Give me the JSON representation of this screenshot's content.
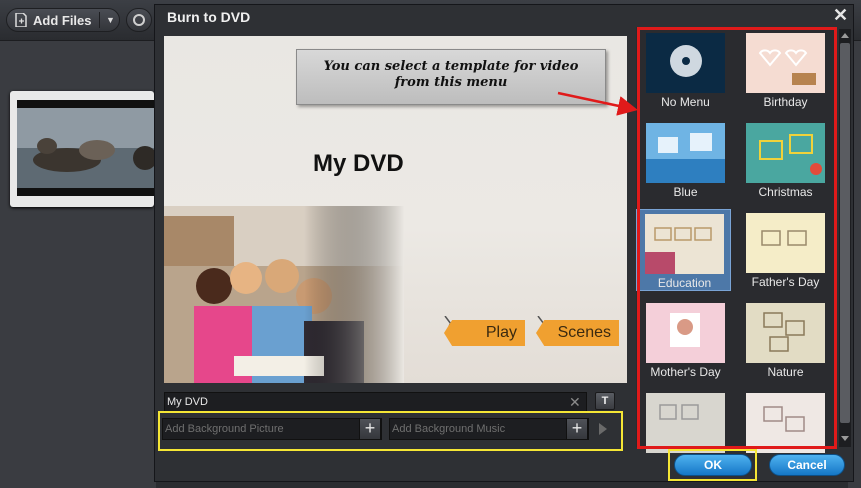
{
  "toolbar": {
    "add_files_label": "Add Files"
  },
  "dialog": {
    "title": "Burn to DVD",
    "close_label": "✕"
  },
  "preview": {
    "callout_line1": "You can select a template for video",
    "callout_line2": "from this menu",
    "dvd_title": "My DVD",
    "play_label": "Play",
    "scenes_label": "Scenes"
  },
  "fields": {
    "title_value": "My DVD",
    "clear_label": "✕",
    "text_button": "T",
    "bg_picture_placeholder": "Add Background Picture",
    "bg_music_placeholder": "Add Background Music",
    "plus": "+"
  },
  "templates": [
    {
      "label": "No Menu"
    },
    {
      "label": "Birthday"
    },
    {
      "label": "Blue"
    },
    {
      "label": "Christmas"
    },
    {
      "label": "Education",
      "selected": true
    },
    {
      "label": "Father's Day"
    },
    {
      "label": "Mother's Day"
    },
    {
      "label": "Nature"
    },
    {
      "label": ""
    },
    {
      "label": ""
    }
  ],
  "buttons": {
    "ok": "OK",
    "cancel": "Cancel"
  },
  "colors": {
    "highlight_red": "#e01a1a",
    "highlight_yellow": "#f5e635",
    "button_blue": "#1577c6",
    "menu_orange": "#f0a030"
  }
}
